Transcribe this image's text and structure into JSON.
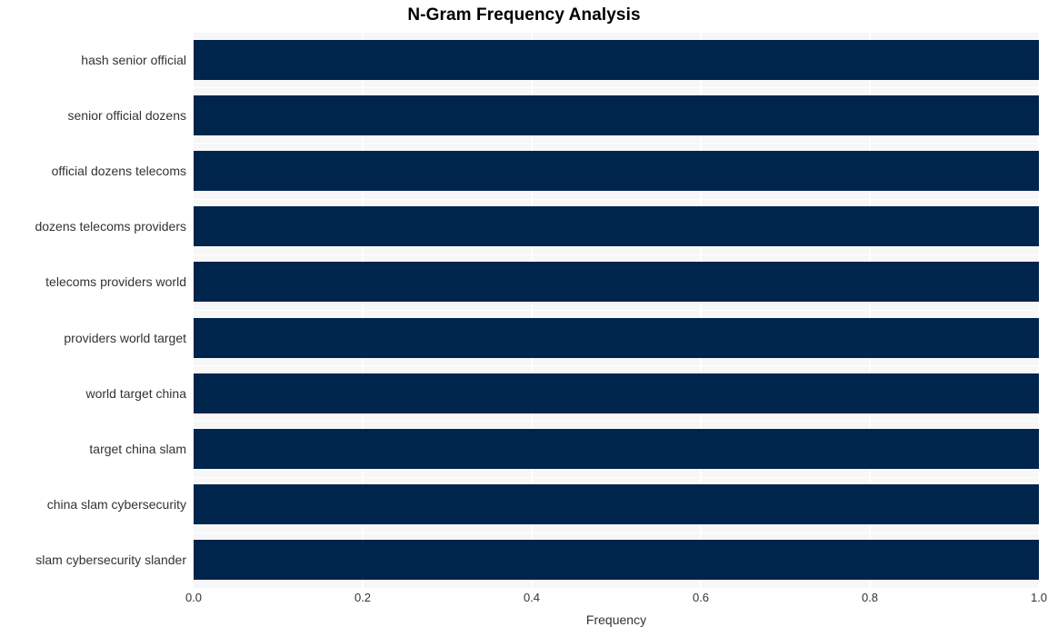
{
  "chart_data": {
    "type": "bar",
    "orientation": "horizontal",
    "title": "N-Gram Frequency Analysis",
    "xlabel": "Frequency",
    "ylabel": "",
    "categories": [
      "hash senior official",
      "senior official dozens",
      "official dozens telecoms",
      "dozens telecoms providers",
      "telecoms providers world",
      "providers world target",
      "world target china",
      "target china slam",
      "china slam cybersecurity",
      "slam cybersecurity slander"
    ],
    "values": [
      1.0,
      1.0,
      1.0,
      1.0,
      1.0,
      1.0,
      1.0,
      1.0,
      1.0,
      1.0
    ],
    "xlim": [
      0.0,
      1.0
    ],
    "xticks": [
      "0.0",
      "0.2",
      "0.4",
      "0.6",
      "0.8",
      "1.0"
    ],
    "xtick_values": [
      0.0,
      0.2,
      0.4,
      0.6,
      0.8,
      1.0
    ],
    "grid": true,
    "legend": null,
    "bar_color": "#00254d",
    "plot_background": "#f7f7f7",
    "gridline_color": "#ffffff",
    "figure_background": "#ffffff",
    "text_color": "#333333",
    "title_color": "#000000"
  }
}
